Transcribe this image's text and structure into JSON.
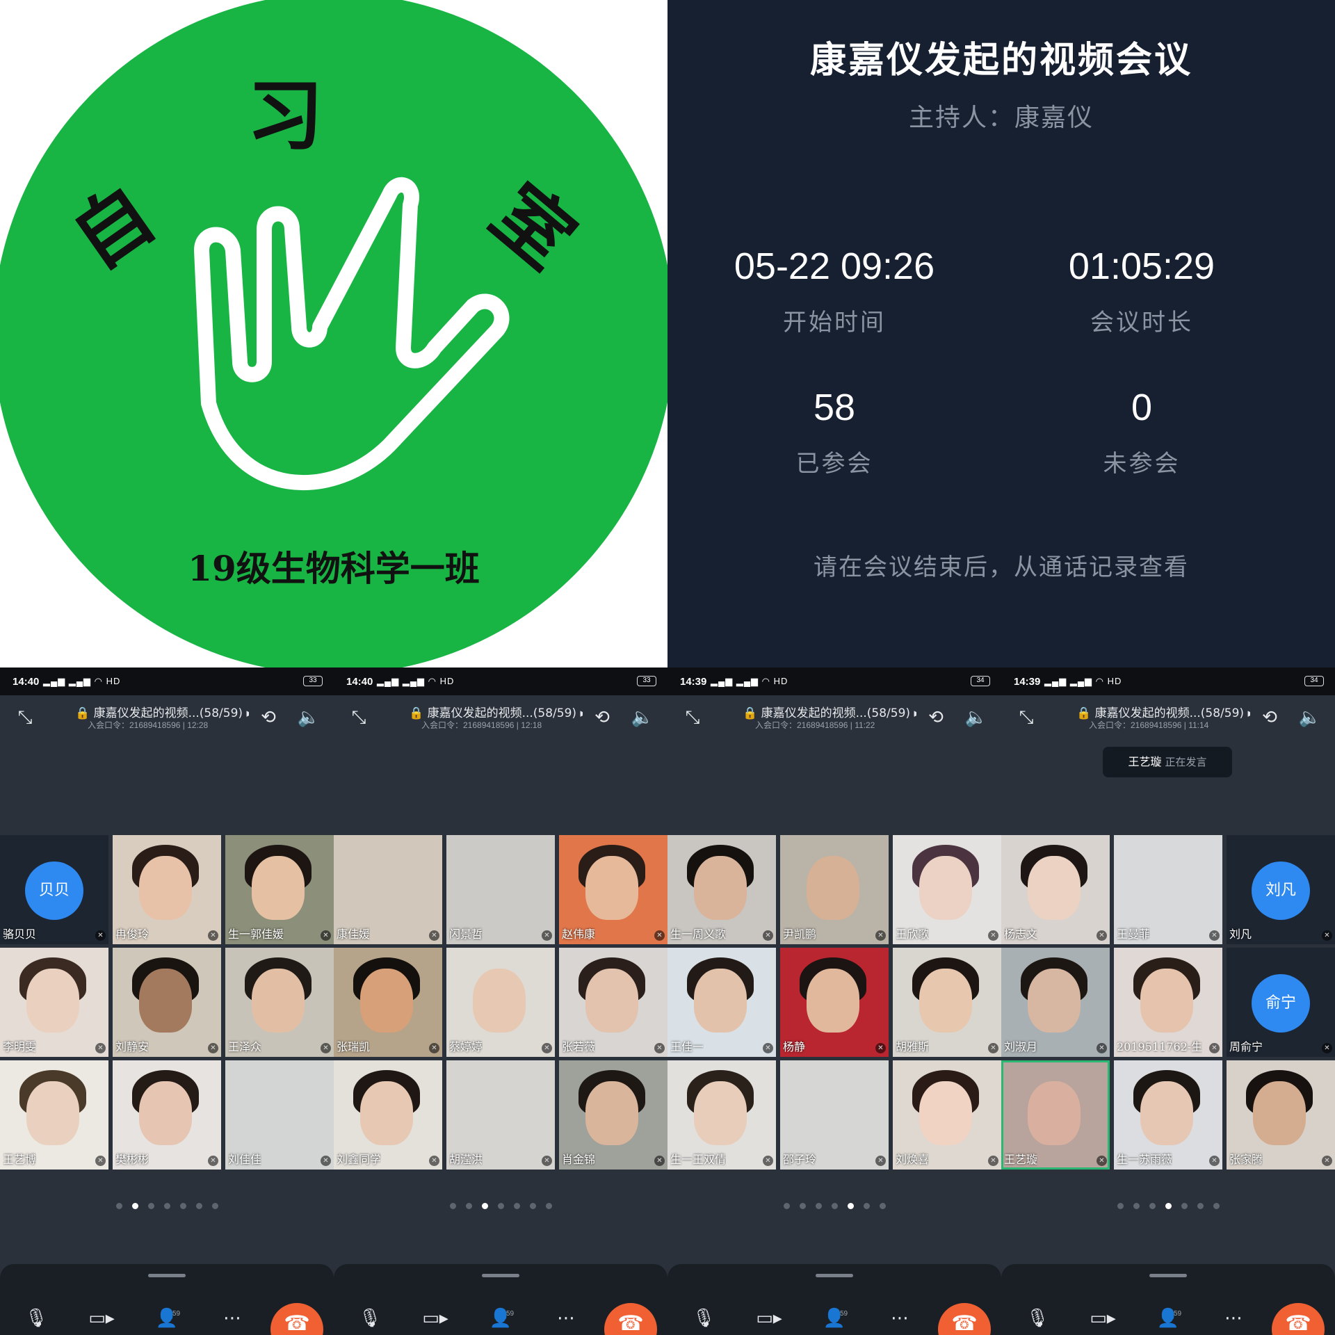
{
  "logo": {
    "chars": [
      "自",
      "习",
      "室"
    ],
    "caption": "19级生物科学一班",
    "colors": {
      "circle": "#18b444",
      "text": "#111111",
      "hand": "#ffffff"
    }
  },
  "summary": {
    "title": "康嘉仪发起的视频会议",
    "host": "主持人：康嘉仪",
    "start_value": "05-22 09:26",
    "start_label": "开始时间",
    "duration_value": "01:05:29",
    "duration_label": "会议时长",
    "joined_value": "58",
    "joined_label": "已参会",
    "absent_value": "0",
    "absent_label": "未参会",
    "note": "请在会议结束后，从通话记录查看"
  },
  "phones": [
    {
      "time": "14:40",
      "net": "HD",
      "battery": "33",
      "title": "康嘉仪发起的视频...(58/59)",
      "subtitle": "入会口令：21689418596 | 12:28",
      "participants_badge": "59",
      "page_dot_active": 1,
      "tiles": [
        {
          "name": "骆贝贝",
          "avatar": "贝贝"
        },
        {
          "name": "冉俊玲",
          "bg": "#d9cdbf",
          "skin": "#e8c2a8",
          "hair": "#2a1d18"
        },
        {
          "name": "生一郭佳媛",
          "bg": "#8c8f7a",
          "skin": "#e5c0a3",
          "hair": "#1c1512"
        },
        {
          "name": "李明雯",
          "bg": "#e5dcd6",
          "skin": "#ead0bf",
          "hair": "#3a2a22"
        },
        {
          "name": "刘静安",
          "bg": "#cfc7ba",
          "skin": "#a47a5f",
          "hair": "#1a1410"
        },
        {
          "name": "王泽众",
          "bg": "#c8c3b8",
          "skin": "#e2bfa4",
          "hair": "#1f1a16"
        },
        {
          "name": "王艺博",
          "bg": "#ece8e2",
          "skin": "#ead1bf",
          "hair": "#4a3a2a"
        },
        {
          "name": "樊彬彬",
          "bg": "#e7e3e0",
          "skin": "#e6c5b3",
          "hair": "#241a16"
        },
        {
          "name": "刘佳佳",
          "bg": "#d3d4d4"
        }
      ]
    },
    {
      "time": "14:40",
      "net": "HD",
      "battery": "33",
      "title": "康嘉仪发起的视频...(58/59)",
      "subtitle": "入会口令：21689418596 | 12:18",
      "participants_badge": "59",
      "page_dot_active": 2,
      "tiles": [
        {
          "name": "康佳媛",
          "bg": "#d1c8bb"
        },
        {
          "name": "闪景哲",
          "bg": "#cbcac6"
        },
        {
          "name": "赵伟康",
          "bg": "#e1764a",
          "skin": "#e6b99a",
          "hair": "#2a1d18"
        },
        {
          "name": "张瑞凯",
          "bg": "#b6a48a",
          "skin": "#d8a078",
          "hair": "#14100d"
        },
        {
          "name": "蔡婷婷",
          "bg": "#dedad4",
          "skin": "#e7c9b3"
        },
        {
          "name": "张若薇",
          "bg": "#d8d5d2",
          "skin": "#e3c3ad",
          "hair": "#2a1f1a"
        },
        {
          "name": "刘鑫同学",
          "bg": "#e4e0da",
          "skin": "#e7c8b2",
          "hair": "#1f1714"
        },
        {
          "name": "胡滢洪",
          "bg": "#d6d4d1"
        },
        {
          "name": "肖金锦",
          "bg": "#9fa19b",
          "skin": "#d9b59b",
          "hair": "#1e1814"
        }
      ]
    },
    {
      "time": "14:39",
      "net": "HD",
      "battery": "34",
      "title": "康嘉仪发起的视频...(58/59)",
      "subtitle": "入会口令：21689418596 | 11:22",
      "participants_badge": "59",
      "page_dot_active": 4,
      "tiles": [
        {
          "name": "生一周义歌",
          "bg": "#c9c6c2",
          "skin": "#d9b49b",
          "hair": "#15110e"
        },
        {
          "name": "尹凯鹏",
          "bg": "#b9b3a8",
          "skin": "#d7b195"
        },
        {
          "name": "王欣歌",
          "bg": "#e4e2e1",
          "skin": "#ecd2c4",
          "hair": "#4b3340"
        },
        {
          "name": "王佳一",
          "bg": "#d9e1e6",
          "skin": "#e3c2ab",
          "hair": "#221a16"
        },
        {
          "name": "杨静",
          "bg": "#b9262f",
          "skin": "#e2b89c",
          "hair": "#1b1412"
        },
        {
          "name": "胡雅斯",
          "bg": "#d9d6cf",
          "skin": "#e7c7ae",
          "hair": "#1c1511"
        },
        {
          "name": "生一王双倩",
          "bg": "#e2e0dd",
          "skin": "#e8cdbb",
          "hair": "#2b211b"
        },
        {
          "name": "邵子玲",
          "bg": "#d6d6d4"
        },
        {
          "name": "刘焕喜",
          "bg": "#ded8d0",
          "skin": "#f0d3c2",
          "hair": "#2a1b16"
        }
      ]
    },
    {
      "time": "14:39",
      "net": "HD",
      "battery": "34",
      "title": "康嘉仪发起的视频...(58/59)",
      "subtitle": "入会口令：21689418596 | 11:14",
      "participants_badge": "59",
      "page_dot_active": 3,
      "speaking_name": "王艺璇",
      "speaking_label": "正在发言",
      "tiles": [
        {
          "name": "杨志文",
          "bg": "#d9d3cf",
          "skin": "#ecd2c2",
          "hair": "#1d1614"
        },
        {
          "name": "王曼菲",
          "bg": "#d8d9db"
        },
        {
          "name": "刘凡",
          "avatar": "刘凡"
        },
        {
          "name": "刘淑月",
          "bg": "#a9b0b3",
          "skin": "#d8b7a2",
          "hair": "#1d1714"
        },
        {
          "name": "2019511762-生",
          "bg": "#e0d8d4",
          "skin": "#e6c3ad",
          "hair": "#2a1e18"
        },
        {
          "name": "周俞宁",
          "avatar": "俞宁"
        },
        {
          "name": "王艺璇",
          "bg": "#b8a49c",
          "skin": "#d9b0a0",
          "active": true
        },
        {
          "name": "生一苏雨薇",
          "bg": "#dcdde0",
          "skin": "#e6c7b4",
          "hair": "#1d1714"
        },
        {
          "name": "张家腾",
          "bg": "#d7d1c9",
          "skin": "#d4ad90",
          "hair": "#17120f"
        }
      ]
    }
  ]
}
